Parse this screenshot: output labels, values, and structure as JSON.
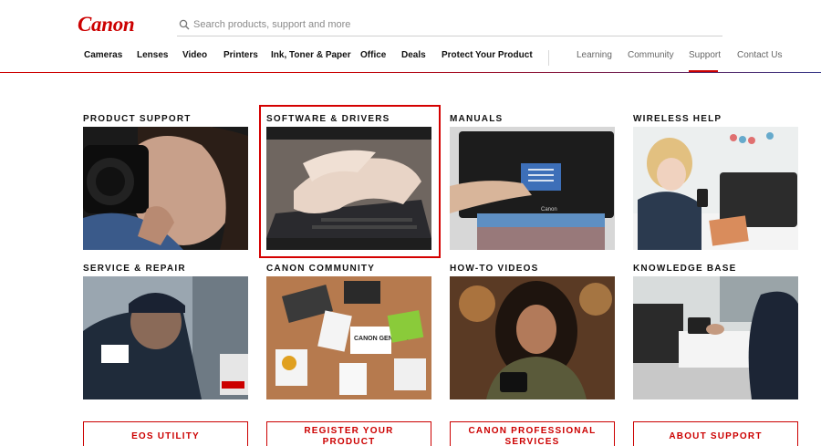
{
  "brand": {
    "logo_text": "Canon",
    "accent": "#cc0000"
  },
  "search": {
    "placeholder": "Search products, support and more",
    "icon": "search-icon"
  },
  "nav": {
    "primary": [
      "Cameras",
      "Lenses",
      "Video",
      "Printers",
      "Ink, Toner & Paper",
      "Office",
      "Deals",
      "Protect Your Product"
    ],
    "secondary": [
      "Learning",
      "Community",
      "Support",
      "Contact Us"
    ],
    "active": "Support"
  },
  "tiles": [
    {
      "title": "PRODUCT SUPPORT"
    },
    {
      "title": "SOFTWARE & DRIVERS",
      "highlighted": true
    },
    {
      "title": "MANUALS"
    },
    {
      "title": "WIRELESS HELP"
    },
    {
      "title": "SERVICE & REPAIR"
    },
    {
      "title": "CANON COMMUNITY"
    },
    {
      "title": "HOW-TO VIDEOS"
    },
    {
      "title": "KNOWLEDGE BASE"
    }
  ],
  "buttons": [
    {
      "label": "EOS UTILITY"
    },
    {
      "label_line1": "REGISTER YOUR",
      "label_line2": "PRODUCT"
    },
    {
      "label_line1": "CANON PROFESSIONAL",
      "label_line2": "SERVICES"
    },
    {
      "label": "ABOUT SUPPORT"
    }
  ],
  "images": {
    "manuals_printer_brand": "Canon",
    "community_paper_label": "CANON GENUINE"
  }
}
